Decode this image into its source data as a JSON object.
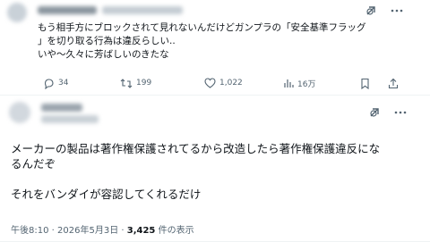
{
  "top_tweet": {
    "text_lines": [
      "もう相手方にブロックされて見れないんだけどガンプラの「安全基準フラッグ",
      "」を切り取る行為は違反らしい..",
      "いや〜久々に芳ばしいのきたな"
    ],
    "actions": {
      "replies": "34",
      "reposts": "199",
      "likes": "1,022",
      "views": "16万"
    },
    "icons": [
      "grok-icon",
      "more-icon",
      "reply-icon",
      "repost-icon",
      "like-icon",
      "views-icon",
      "bookmark-icon",
      "share-icon"
    ]
  },
  "reply_tweet": {
    "text_lines": [
      "メーカーの製品は著作権保護されてるから改造したら著作権保護違反にな",
      "るんだぞ",
      "",
      "それをバンダイが容認してくれるだけ"
    ],
    "meta": {
      "time": "午後8:10",
      "sep1": " · ",
      "date": "2026年5月3日",
      "sep2": " · ",
      "views_count": "3,425",
      "views_label": " 件の表示"
    },
    "icons": [
      "grok-icon",
      "more-icon"
    ]
  },
  "colors": {
    "text": "#0f1419",
    "secondary": "#536471",
    "divider": "#eff3f4"
  }
}
